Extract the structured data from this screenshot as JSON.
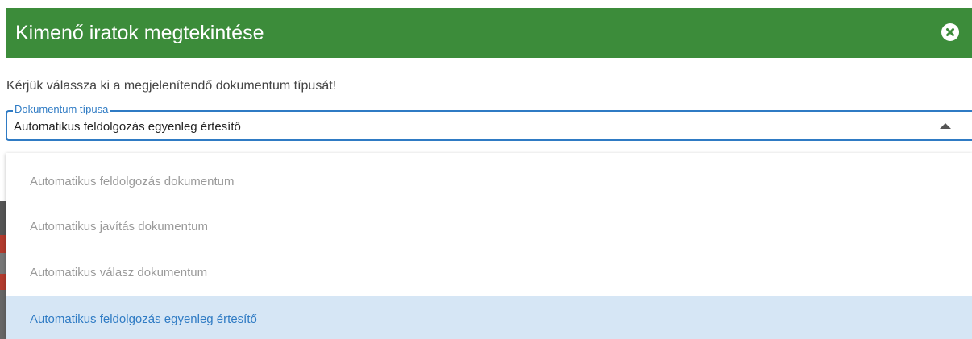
{
  "dialog": {
    "title": "Kimenő iratok megtekintése",
    "close_icon": "close-circle-icon",
    "prompt": "Kérjük válassza ki a megjelenítendő dokumentum típusát!"
  },
  "select": {
    "label": "Dokumentum típusa",
    "value": "Automatikus feldolgozás egyenleg értesítő",
    "expanded": true,
    "caret_icon": "caret-up-icon",
    "options": [
      {
        "label": "Automatikus feldolgozás dokumentum",
        "selected": false
      },
      {
        "label": "Automatikus javítás dokumentum",
        "selected": false
      },
      {
        "label": "Automatikus válasz dokumentum",
        "selected": false
      },
      {
        "label": "Automatikus feldolgozás egyenleg értesítő",
        "selected": true
      }
    ]
  },
  "colors": {
    "header_bg": "#3c8c3a",
    "accent": "#2f7bc4",
    "selected_option_bg": "#d6e6f5",
    "muted_option_text": "#9a9a9a"
  }
}
